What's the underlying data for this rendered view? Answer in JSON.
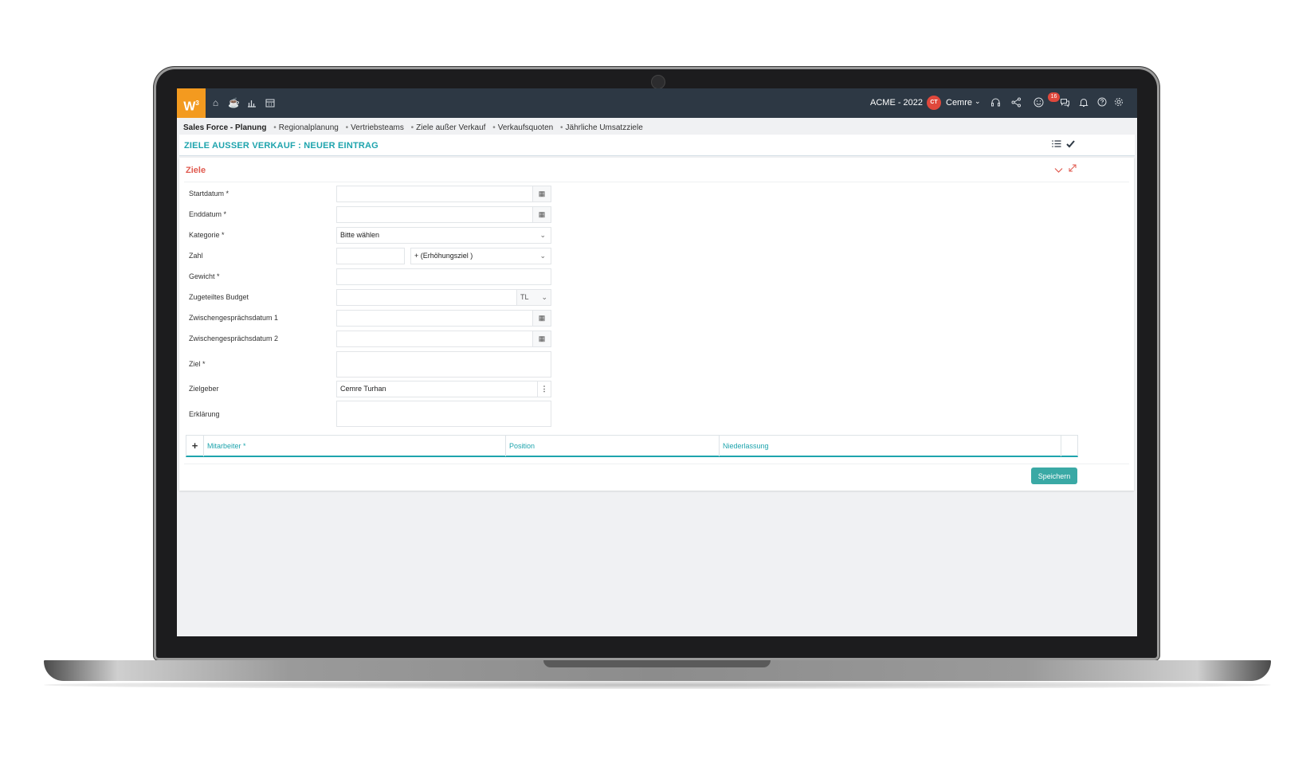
{
  "topbar": {
    "logo": "W",
    "logo_sup": "3",
    "company": "ACME - 2022",
    "avatar_initials": "CT",
    "username": "Cemre",
    "notification_count": "16"
  },
  "breadcrumb": [
    "Sales Force - Planung",
    "Regionalplanung",
    "Vertriebsteams",
    "Ziele außer Verkauf",
    "Verkaufsquoten",
    "Jährliche Umsatzziele"
  ],
  "page_title": "ZIELE AUSSER VERKAUF : NEUER EINTRAG",
  "card_title": "Ziele",
  "form": {
    "startdatum": "Startdatum *",
    "enddatum": "Enddatum *",
    "kategorie": "Kategorie *",
    "kategorie_value": "Bitte wählen",
    "zahl": "Zahl",
    "zahl_type": "+ (Erhöhungsziel )",
    "gewicht": "Gewicht *",
    "budget": "Zugeteiltes Budget",
    "budget_currency": "TL",
    "zwischen1": "Zwischengesprächsdatum 1",
    "zwischen2": "Zwischengesprächsdatum 2",
    "ziel": "Ziel *",
    "zielgeber": "Zielgeber",
    "zielgeber_value": "Cemre Turhan",
    "erklaerung": "Erklärung"
  },
  "grid": {
    "columns": [
      "Mitarbeiter *",
      "Position",
      "Niederlassung"
    ]
  },
  "save_label": "Speichern",
  "colors": {
    "topbar": "#2d3844",
    "logo": "#f39a1f",
    "accent": "#1ea4ad",
    "card_title": "#e05a4f",
    "save_button": "#3aa9a5"
  }
}
